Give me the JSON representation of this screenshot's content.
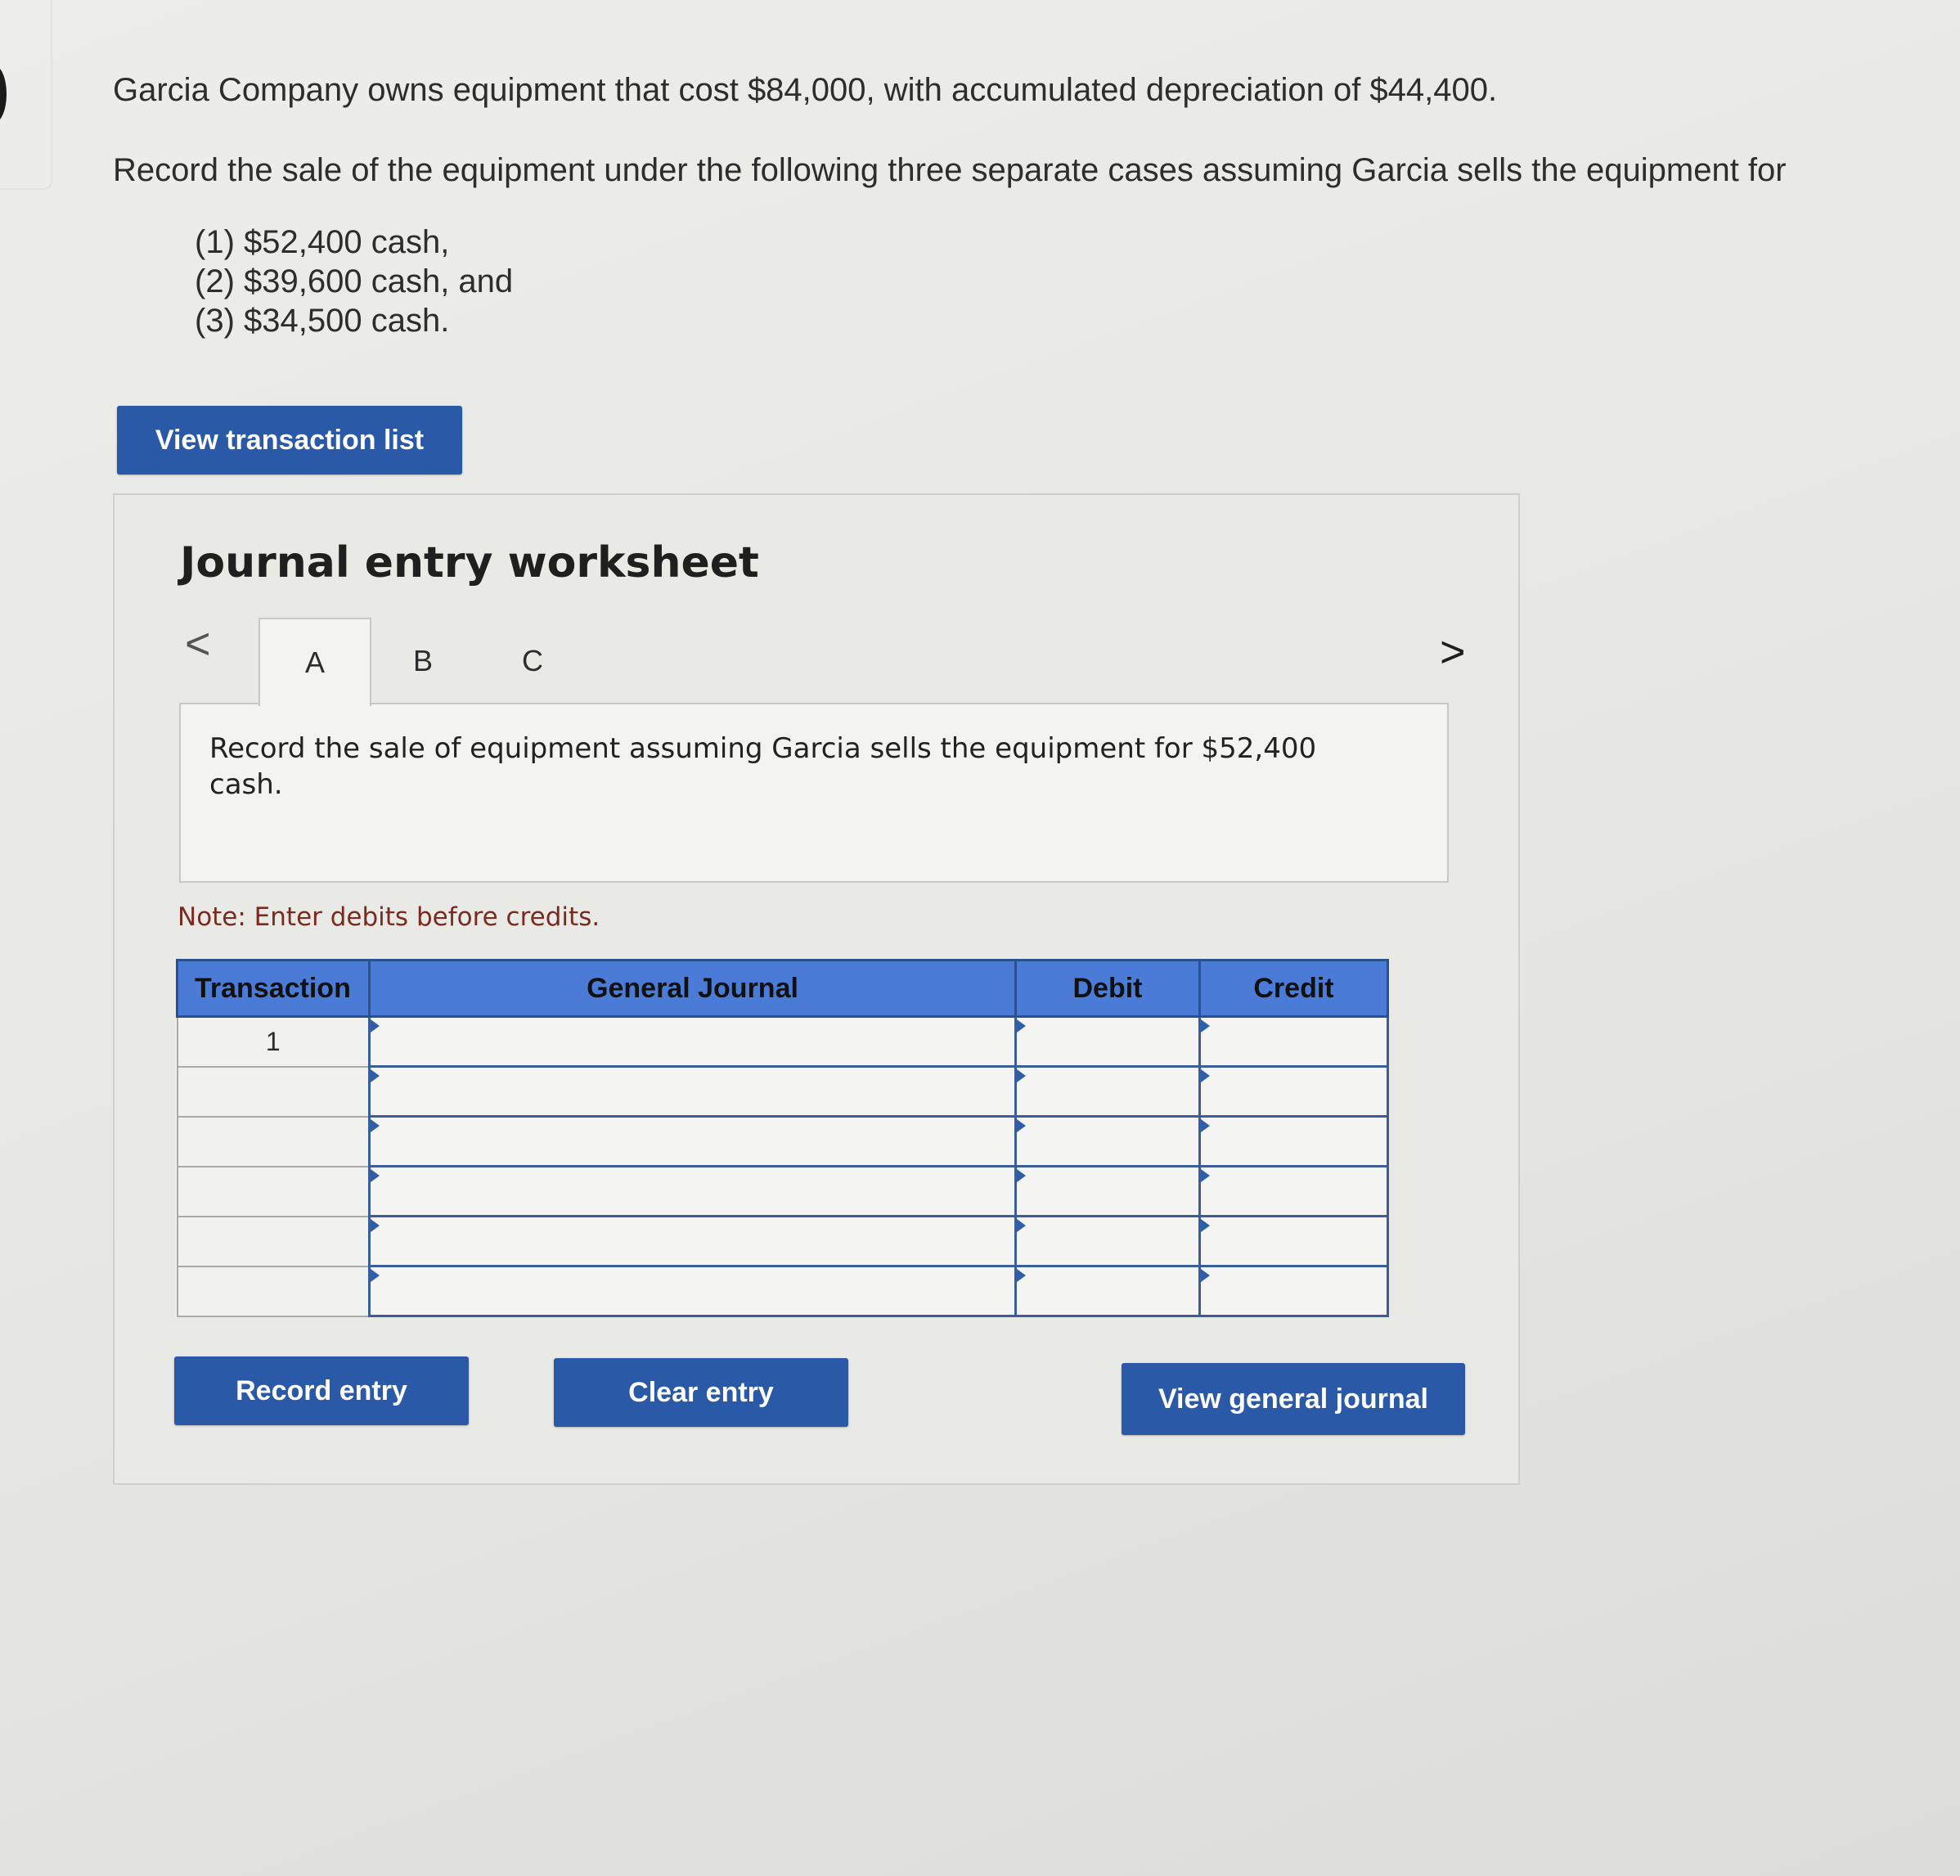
{
  "problem": {
    "statement": "Garcia Company owns equipment that cost $84,000, with accumulated depreciation of $44,400.",
    "instruction": "Record the sale of the equipment under the following three separate cases assuming Garcia sells the equipment for",
    "cases": [
      "(1) $52,400 cash,",
      "(2) $39,600 cash, and",
      "(3) $34,500 cash."
    ]
  },
  "buttons": {
    "view_transaction_list": "View transaction list",
    "record_entry": "Record entry",
    "clear_entry": "Clear entry",
    "view_general_journal": "View general journal"
  },
  "worksheet": {
    "title": "Journal entry worksheet",
    "nav_prev": "<",
    "nav_next": ">",
    "tabs": [
      {
        "label": "A",
        "active": true
      },
      {
        "label": "B",
        "active": false
      },
      {
        "label": "C",
        "active": false
      }
    ],
    "prompt": "Record the sale of equipment assuming Garcia sells the equipment for $52,400 cash.",
    "note": "Note: Enter debits before credits."
  },
  "journal": {
    "headers": [
      "Transaction",
      "General Journal",
      "Debit",
      "Credit"
    ],
    "rows": [
      {
        "transaction": "1",
        "account": "",
        "debit": "",
        "credit": ""
      },
      {
        "transaction": "",
        "account": "",
        "debit": "",
        "credit": ""
      },
      {
        "transaction": "",
        "account": "",
        "debit": "",
        "credit": ""
      },
      {
        "transaction": "",
        "account": "",
        "debit": "",
        "credit": ""
      },
      {
        "transaction": "",
        "account": "",
        "debit": "",
        "credit": ""
      },
      {
        "transaction": "",
        "account": "",
        "debit": "",
        "credit": ""
      }
    ]
  },
  "colors": {
    "button_blue": "#2a5aa7",
    "header_blue": "#4a7bd6",
    "note_red": "#7a2b20"
  }
}
